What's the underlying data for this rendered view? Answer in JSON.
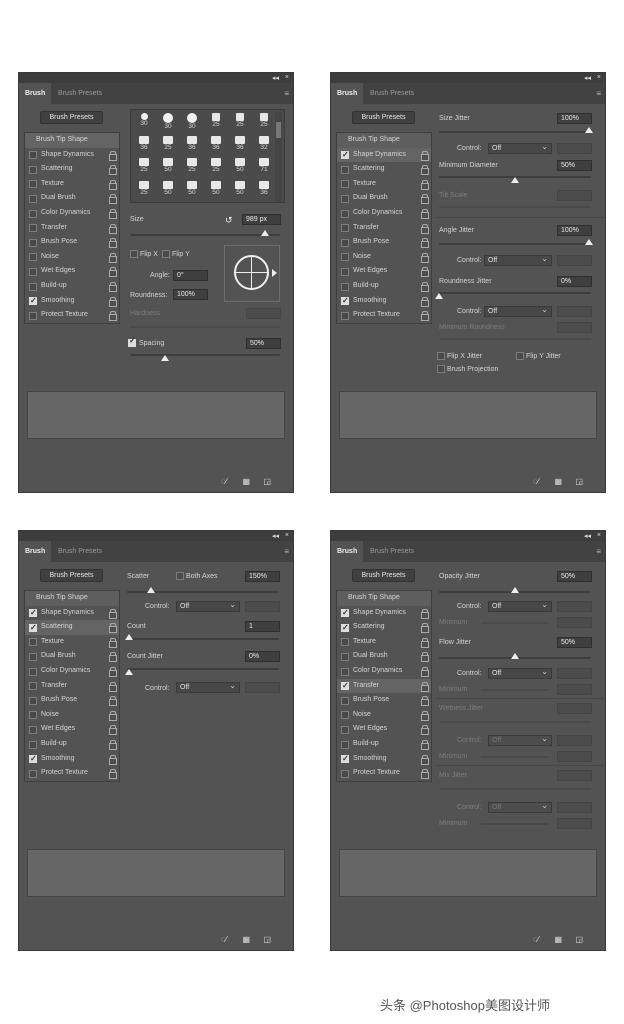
{
  "common": {
    "tab_brush": "Brush",
    "tab_presets": "Brush Presets",
    "presets_button": "Brush Presets",
    "topbar_collapse": "◂◂",
    "topbar_close": "×",
    "menu": "≡",
    "bottom_icons": [
      "◌⁄",
      "▦",
      "◲"
    ]
  },
  "side_items": [
    "Shape Dynamics",
    "Scattering",
    "Texture",
    "Dual Brush",
    "Color Dynamics",
    "Transfer",
    "Brush Pose",
    "Noise",
    "Wet Edges",
    "Build-up",
    "Smoothing",
    "Protect Texture"
  ],
  "side_head": "Brush Tip Shape",
  "panel1": {
    "tips": [
      [
        "30",
        "30",
        "30",
        "25",
        "25",
        "25"
      ],
      [
        "36",
        "25",
        "36",
        "36",
        "36",
        "32"
      ],
      [
        "25",
        "50",
        "25",
        "25",
        "50",
        "71"
      ],
      [
        "25",
        "50",
        "50",
        "50",
        "50",
        "36"
      ]
    ],
    "size_label": "Size",
    "size_value": "989 px",
    "flip_x": "Flip X",
    "flip_y": "Flip Y",
    "angle_label": "Angle:",
    "angle_value": "0°",
    "roundness_label": "Roundness:",
    "roundness_value": "100%",
    "hardness_label": "Hardness",
    "spacing_label": "Spacing",
    "spacing_value": "50%"
  },
  "panel2": {
    "size_jitter": "Size Jitter",
    "size_jitter_value": "100%",
    "control": "Control:",
    "off": "Off",
    "min_diameter": "Minimum Diameter",
    "min_diameter_value": "50%",
    "tilt_scale": "Tilt Scale",
    "angle_jitter": "Angle Jitter",
    "angle_jitter_value": "100%",
    "roundness_jitter": "Roundness Jitter",
    "roundness_jitter_value": "0%",
    "min_roundness": "Minimum Roundness",
    "flip_x_jitter": "Flip X Jitter",
    "flip_y_jitter": "Flip Y Jitter",
    "brush_projection": "Brush Projection"
  },
  "panel3": {
    "scatter": "Scatter",
    "both_axes": "Both Axes",
    "scatter_value": "150%",
    "control": "Control:",
    "off": "Off",
    "count": "Count",
    "count_value": "1",
    "count_jitter": "Count Jitter",
    "count_jitter_value": "0%"
  },
  "panel4": {
    "opacity_jitter": "Opacity Jitter",
    "opacity_jitter_value": "50%",
    "control": "Control:",
    "off": "Off",
    "minimum": "Minimum",
    "flow_jitter": "Flow Jitter",
    "flow_jitter_value": "50%",
    "wetness_jitter": "Wetness Jitter",
    "mix_jitter": "Mix Jitter"
  },
  "watermark": "头条 @Photoshop美图设计师"
}
